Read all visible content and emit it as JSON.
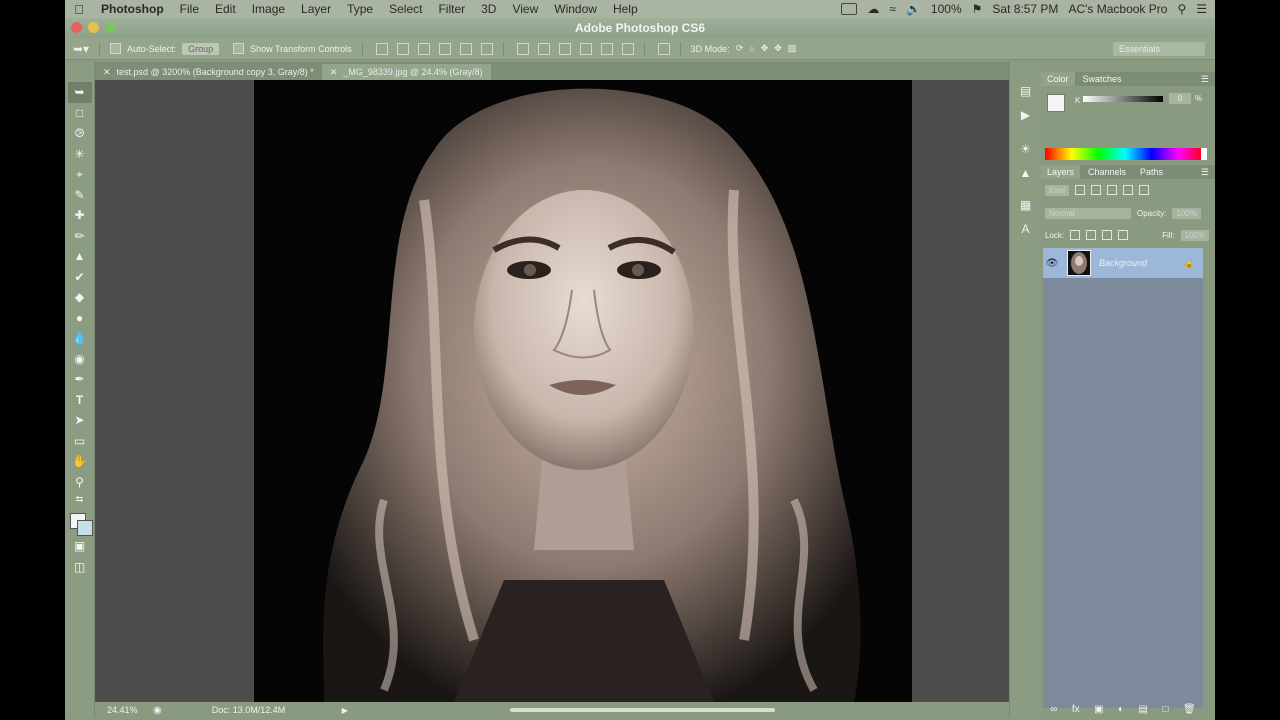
{
  "menubar": {
    "app": "Photoshop",
    "items": [
      "File",
      "Edit",
      "Image",
      "Layer",
      "Type",
      "Select",
      "Filter",
      "3D",
      "View",
      "Window",
      "Help"
    ],
    "battery": "100%",
    "time": "Sat 8:57 PM",
    "user": "AC's Macbook Pro"
  },
  "window": {
    "title": "Adobe Photoshop CS6"
  },
  "options": {
    "auto_select_label": "Auto-Select:",
    "auto_select_value": "Group",
    "show_transform_label": "Show Transform Controls",
    "mode_3d_label": "3D Mode:",
    "workspace": "Essentials"
  },
  "tabs": [
    {
      "label": "test.psd @ 3200% (Background copy 3, Gray/8) *",
      "active": false
    },
    {
      "label": "_MG_98339.jpg @ 24.4% (Gray/8)",
      "active": true
    }
  ],
  "status": {
    "zoom": "24.41%",
    "doc": "Doc: 13.0M/12.4M"
  },
  "color_panel": {
    "tabs": [
      "Color",
      "Swatches"
    ],
    "slider_label": "K",
    "k_value": "0",
    "k_unit": "%"
  },
  "layers_panel": {
    "tabs": [
      "Layers",
      "Channels",
      "Paths"
    ],
    "filter_kind": "Kind",
    "blend_mode": "Normal",
    "opacity_label": "Opacity:",
    "opacity_value": "100%",
    "lock_label": "Lock:",
    "fill_label": "Fill:",
    "fill_value": "100%",
    "layers": [
      {
        "name": "Background",
        "visible": true,
        "locked": true
      }
    ]
  },
  "colors": {
    "accent_selection": "#9db7d8",
    "ui_tint": "#8a9a80"
  }
}
